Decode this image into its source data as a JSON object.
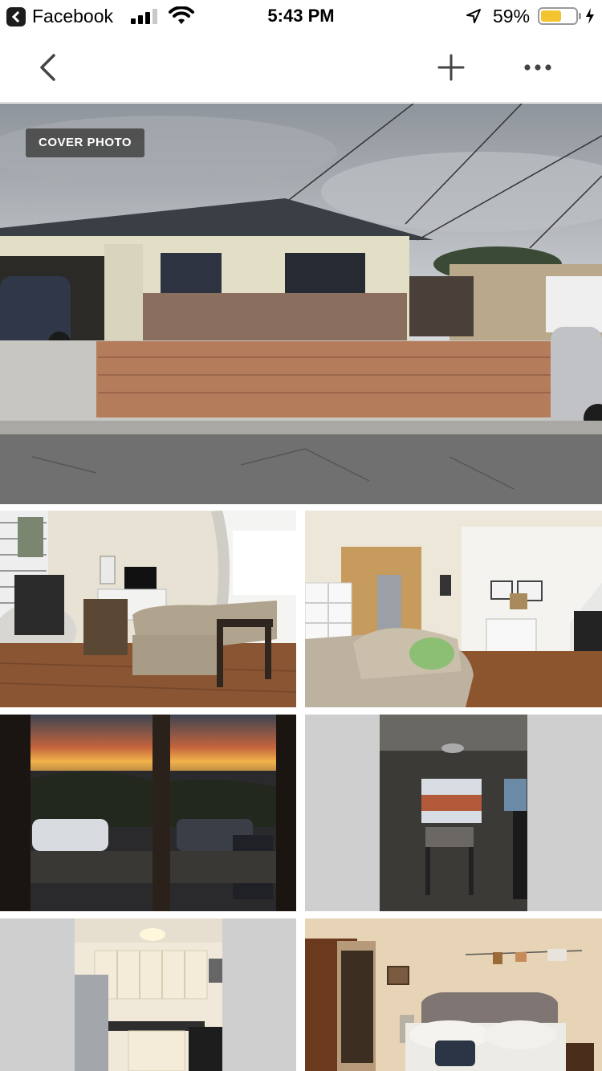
{
  "status_bar": {
    "back_app": "Facebook",
    "time": "5:43 PM",
    "battery": "59%",
    "battery_level": 0.59
  },
  "nav": {
    "back_icon": "chevron-left-icon",
    "add_icon": "plus-icon",
    "more_icon": "more-dots-icon"
  },
  "cover": {
    "badge": "COVER PHOTO"
  },
  "colors": {
    "battery_fill": "#f4c430",
    "badge_bg": "#464646"
  }
}
